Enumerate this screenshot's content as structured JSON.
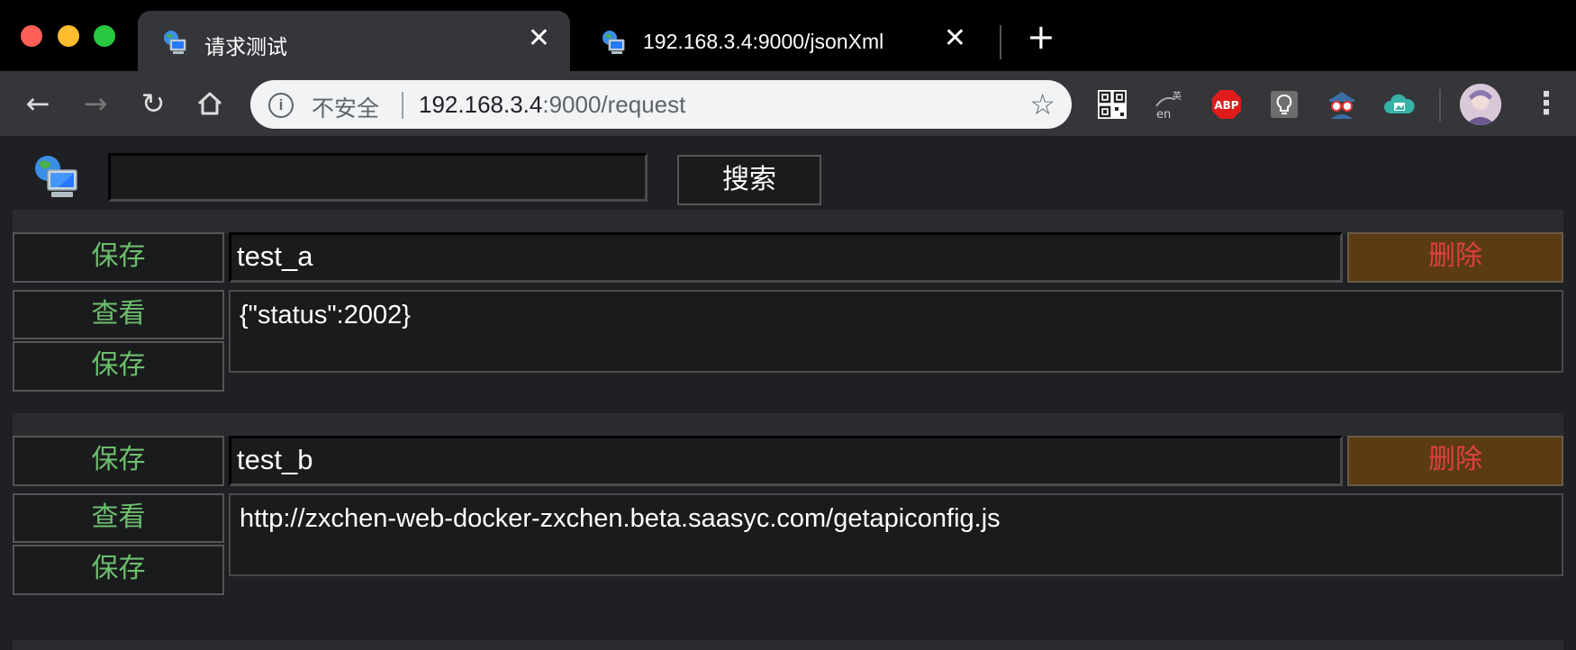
{
  "tabs": [
    {
      "title": "请求测试",
      "active": true
    },
    {
      "title": "192.168.3.4:9000/jsonXml",
      "active": false
    }
  ],
  "toolbar": {
    "security_label": "不安全",
    "url_host": "192.168.3.4",
    "url_path": ":9000/request",
    "extensions": [
      "qr-code-icon",
      "translate-icon",
      "adblock-icon",
      "lightbulb-icon",
      "spy-icon",
      "cloud-image-icon"
    ],
    "adblock_label": "ABP"
  },
  "page": {
    "search_button": "搜索",
    "search_value": ""
  },
  "requests": [
    {
      "name": "test_a",
      "save_label": "保存",
      "delete_label": "删除",
      "view_label": "查看",
      "save2_label": "保存",
      "content": "{\"status\":2002}"
    },
    {
      "name": "test_b",
      "save_label": "保存",
      "delete_label": "删除",
      "view_label": "查看",
      "save2_label": "保存",
      "content": "http://zxchen-web-docker-zxchen.beta.saasyc.com/getapiconfig.js"
    }
  ],
  "colors": {
    "save_text": "#6dbf6d",
    "delete_text": "#e04040",
    "delete_bg": "#5a3b12"
  }
}
